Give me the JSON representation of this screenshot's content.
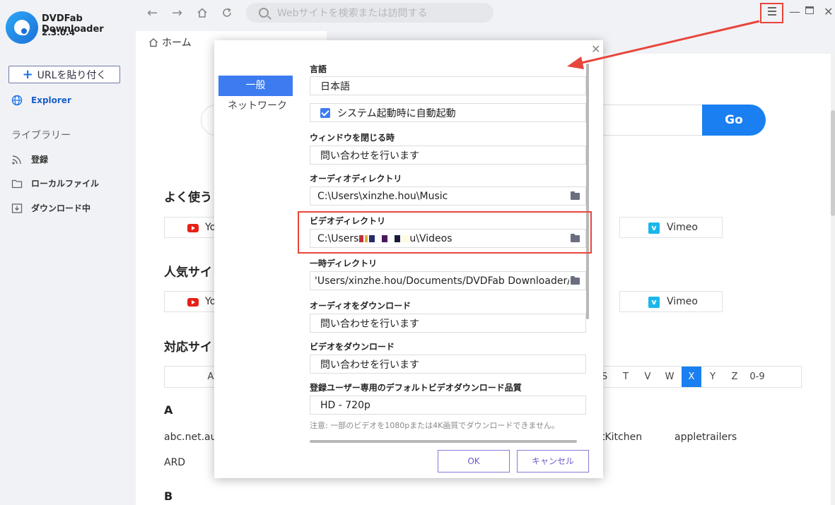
{
  "app": {
    "name": "DVDFab Downloader",
    "version": "2.3.0.4"
  },
  "sidebar": {
    "paste_button": "URLを貼り付く",
    "explorer": "Explorer",
    "library_title": "ライブラリー",
    "items": [
      {
        "label": "登録",
        "icon": "rss-icon"
      },
      {
        "label": "ローカルファイル",
        "icon": "folder-icon"
      },
      {
        "label": "ダウンロード中",
        "icon": "download-icon"
      }
    ]
  },
  "topbar": {
    "search_placeholder": "Webサイトを検索または訪問する"
  },
  "tab": {
    "label": "ホーム"
  },
  "main": {
    "go_label": "Go",
    "sec1_title": "よく使う",
    "sec2_title": "人気サイ",
    "sec3_title": "対応サイ",
    "yt_label": "Yo",
    "vimeo_label": "Vimeo",
    "letters": [
      "A",
      "S",
      "T",
      "V",
      "W",
      "X",
      "Y",
      "Z",
      "0-9"
    ],
    "selected_letter": "X",
    "group_a": "A",
    "group_b": "B",
    "sites": [
      "abc.net.au:i",
      "tKitchen",
      "appletrailers",
      "ARD"
    ]
  },
  "dialog": {
    "tab_general": "一般",
    "tab_network": "ネットワーク",
    "language_label": "言語",
    "language_value": "日本語",
    "autostart_label": "システム起動時に自動起動",
    "close_label": "ウィンドウを閉じる時",
    "close_value": "問い合わせを行います",
    "audio_dir_label": "オーディオディレクトリ",
    "audio_dir_value": "C:\\Users\\xinzhe.hou\\Music",
    "video_dir_label": "ビデオディレクトリ",
    "video_dir_prefix": "C:\\Users",
    "video_dir_suffix": "u\\Videos",
    "temp_dir_label": "一時ディレクトリ",
    "temp_dir_value": "'Users/xinzhe.hou/Documents/DVDFab Downloader/temp",
    "audio_dl_label": "オーディオをダウンロード",
    "audio_dl_value": "問い合わせを行います",
    "video_dl_label": "ビデオをダウンロード",
    "video_dl_value": "問い合わせを行います",
    "quality_label": "登録ユーザー専用のデフォルトビデオダウンロード品質",
    "quality_value": "HD - 720p",
    "note": "注意: 一部のビデオを1080pまたは4K画質でダウンロードできません。",
    "ok_label": "OK",
    "cancel_label": "キャンセル"
  },
  "colors": {
    "accent": "#1a7ff0",
    "highlight": "#e8453c",
    "dialog_button": "#6e59c9"
  }
}
